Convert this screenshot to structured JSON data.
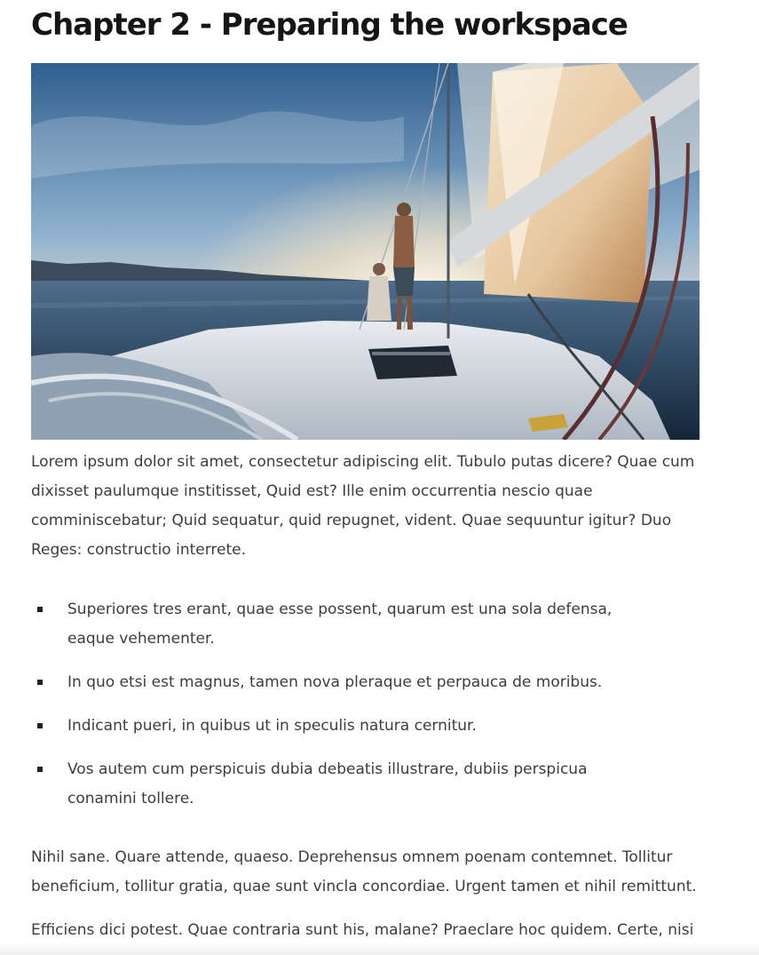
{
  "article": {
    "title": "Chapter 2 - Preparing the workspace",
    "hero_image": {
      "subject": "sailboat-at-sunset",
      "colors": {
        "sky_top": "#3c6c9a",
        "sky_glow": "#f4e7cf",
        "sea": "#203a55",
        "sail": "#e8d3b4",
        "deck": "#d9dde3"
      }
    },
    "paragraph_1": "Lorem ipsum dolor sit amet, consectetur adipiscing elit. Tubulo putas dicere? Quae cum dixisset paulumque institisset, Quid est? Ille enim occurrentia nescio quae comminiscebatur; Quid sequatur, quid repugnet, vident. Quae sequuntur igitur? Duo Reges: constructio interrete.",
    "list_items": [
      "Superiores tres erant, quae esse possent, quarum est una sola defensa, eaque vehementer.",
      "In quo etsi est magnus, tamen nova pleraque et perpauca de moribus.",
      "Indicant pueri, in quibus ut in speculis natura cernitur.",
      "Vos autem cum perspicuis dubia debeatis illustrare, dubiis perspicua conamini tollere."
    ],
    "paragraph_2": "Nihil sane. Quare attende, quaeso. Deprehensus omnem poenam contemnet. Tollitur beneficium, tollitur gratia, quae sunt vincla concordiae. Urgent tamen et nihil remittunt.",
    "paragraph_3": "Efficiens dici potest. Quae contraria sunt his, malane? Praeclare hoc quidem. Certe, nisi"
  }
}
